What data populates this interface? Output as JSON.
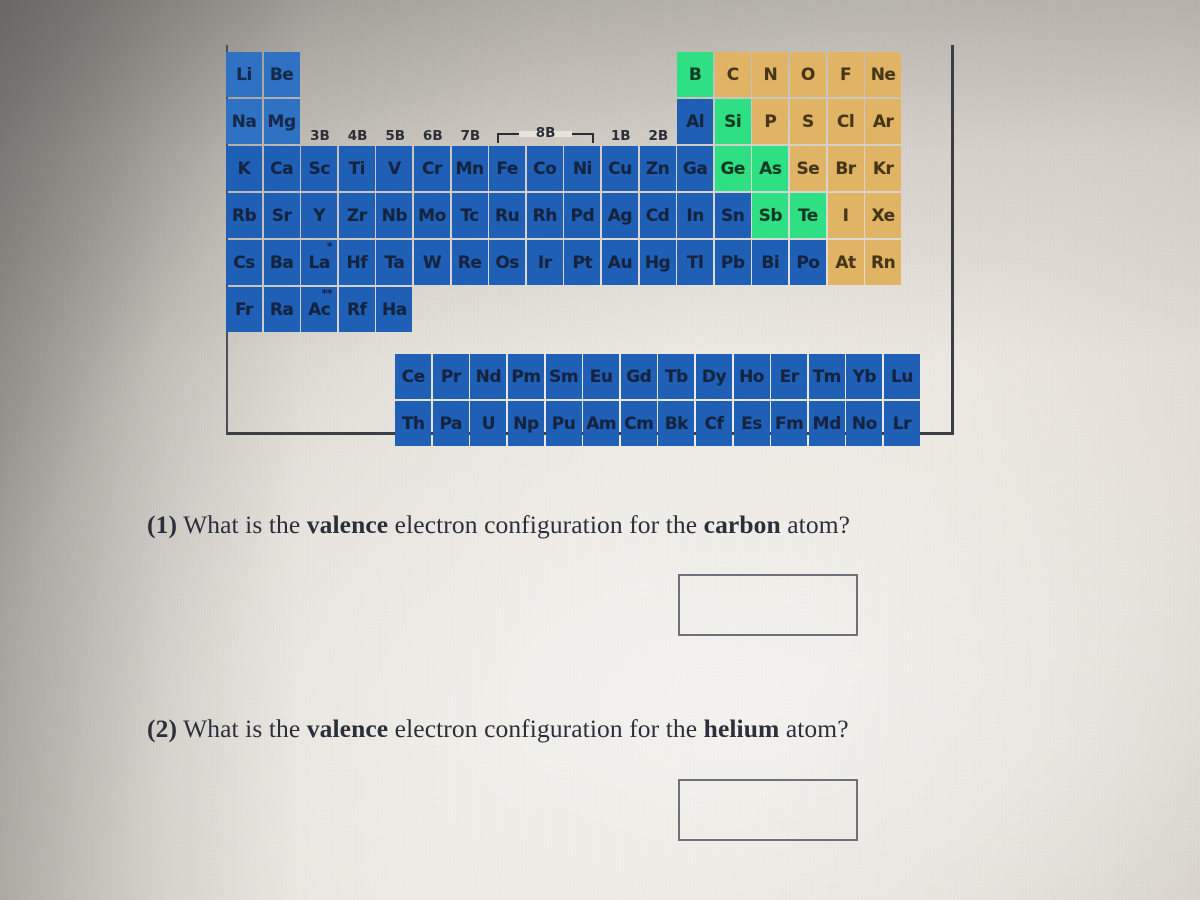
{
  "page": {
    "background_color": "#e7e3db",
    "accent_metal": "#1f60b6",
    "accent_metalloid": "#2fdf83",
    "accent_nonmetal": "#e0b464"
  },
  "periodic_table": {
    "group_labels": [
      "3B",
      "4B",
      "5B",
      "6B",
      "7B",
      "8B",
      "1B",
      "2B"
    ],
    "bracket_label": "8B",
    "rows": [
      {
        "name": "period-2",
        "cells": [
          {
            "symbol": "Li",
            "type": "metal-light"
          },
          {
            "symbol": "Be",
            "type": "metal-light"
          },
          {
            "symbol": "",
            "type": "blank"
          },
          {
            "symbol": "",
            "type": "blank"
          },
          {
            "symbol": "",
            "type": "blank"
          },
          {
            "symbol": "",
            "type": "blank"
          },
          {
            "symbol": "",
            "type": "blank"
          },
          {
            "symbol": "",
            "type": "blank"
          },
          {
            "symbol": "",
            "type": "blank"
          },
          {
            "symbol": "",
            "type": "blank"
          },
          {
            "symbol": "",
            "type": "blank"
          },
          {
            "symbol": "",
            "type": "blank"
          },
          {
            "symbol": "B",
            "type": "metalloid"
          },
          {
            "symbol": "C",
            "type": "nonmetal"
          },
          {
            "symbol": "N",
            "type": "nonmetal"
          },
          {
            "symbol": "O",
            "type": "nonmetal"
          },
          {
            "symbol": "F",
            "type": "nonmetal"
          },
          {
            "symbol": "Ne",
            "type": "nonmetal"
          }
        ]
      },
      {
        "name": "period-3",
        "cells": [
          {
            "symbol": "Na",
            "type": "metal-light"
          },
          {
            "symbol": "Mg",
            "type": "metal-light"
          },
          {
            "symbol": "",
            "type": "blank"
          },
          {
            "symbol": "",
            "type": "blank"
          },
          {
            "symbol": "",
            "type": "blank"
          },
          {
            "symbol": "",
            "type": "blank"
          },
          {
            "symbol": "",
            "type": "blank"
          },
          {
            "symbol": "",
            "type": "blank"
          },
          {
            "symbol": "",
            "type": "blank"
          },
          {
            "symbol": "",
            "type": "blank"
          },
          {
            "symbol": "",
            "type": "blank"
          },
          {
            "symbol": "",
            "type": "blank"
          },
          {
            "symbol": "Al",
            "type": "metal"
          },
          {
            "symbol": "Si",
            "type": "metalloid"
          },
          {
            "symbol": "P",
            "type": "nonmetal"
          },
          {
            "symbol": "S",
            "type": "nonmetal"
          },
          {
            "symbol": "Cl",
            "type": "nonmetal"
          },
          {
            "symbol": "Ar",
            "type": "nonmetal"
          }
        ]
      },
      {
        "name": "period-4",
        "cells": [
          {
            "symbol": "K",
            "type": "metal"
          },
          {
            "symbol": "Ca",
            "type": "metal"
          },
          {
            "symbol": "Sc",
            "type": "metal"
          },
          {
            "symbol": "Ti",
            "type": "metal"
          },
          {
            "symbol": "V",
            "type": "metal"
          },
          {
            "symbol": "Cr",
            "type": "metal"
          },
          {
            "symbol": "Mn",
            "type": "metal"
          },
          {
            "symbol": "Fe",
            "type": "metal"
          },
          {
            "symbol": "Co",
            "type": "metal"
          },
          {
            "symbol": "Ni",
            "type": "metal"
          },
          {
            "symbol": "Cu",
            "type": "metal"
          },
          {
            "symbol": "Zn",
            "type": "metal"
          },
          {
            "symbol": "Ga",
            "type": "metal"
          },
          {
            "symbol": "Ge",
            "type": "metalloid"
          },
          {
            "symbol": "As",
            "type": "metalloid"
          },
          {
            "symbol": "Se",
            "type": "nonmetal"
          },
          {
            "symbol": "Br",
            "type": "nonmetal"
          },
          {
            "symbol": "Kr",
            "type": "nonmetal"
          }
        ]
      },
      {
        "name": "period-5",
        "cells": [
          {
            "symbol": "Rb",
            "type": "metal"
          },
          {
            "symbol": "Sr",
            "type": "metal"
          },
          {
            "symbol": "Y",
            "type": "metal"
          },
          {
            "symbol": "Zr",
            "type": "metal"
          },
          {
            "symbol": "Nb",
            "type": "metal"
          },
          {
            "symbol": "Mo",
            "type": "metal"
          },
          {
            "symbol": "Tc",
            "type": "metal"
          },
          {
            "symbol": "Ru",
            "type": "metal"
          },
          {
            "symbol": "Rh",
            "type": "metal"
          },
          {
            "symbol": "Pd",
            "type": "metal"
          },
          {
            "symbol": "Ag",
            "type": "metal"
          },
          {
            "symbol": "Cd",
            "type": "metal"
          },
          {
            "symbol": "In",
            "type": "metal"
          },
          {
            "symbol": "Sn",
            "type": "metal"
          },
          {
            "symbol": "Sb",
            "type": "metalloid"
          },
          {
            "symbol": "Te",
            "type": "metalloid"
          },
          {
            "symbol": "I",
            "type": "nonmetal"
          },
          {
            "symbol": "Xe",
            "type": "nonmetal"
          }
        ]
      },
      {
        "name": "period-6",
        "cells": [
          {
            "symbol": "Cs",
            "type": "metal"
          },
          {
            "symbol": "Ba",
            "type": "metal"
          },
          {
            "symbol": "La",
            "type": "metal",
            "marker": "*"
          },
          {
            "symbol": "Hf",
            "type": "metal"
          },
          {
            "symbol": "Ta",
            "type": "metal"
          },
          {
            "symbol": "W",
            "type": "metal"
          },
          {
            "symbol": "Re",
            "type": "metal"
          },
          {
            "symbol": "Os",
            "type": "metal"
          },
          {
            "symbol": "Ir",
            "type": "metal"
          },
          {
            "symbol": "Pt",
            "type": "metal"
          },
          {
            "symbol": "Au",
            "type": "metal"
          },
          {
            "symbol": "Hg",
            "type": "metal"
          },
          {
            "symbol": "Tl",
            "type": "metal"
          },
          {
            "symbol": "Pb",
            "type": "metal"
          },
          {
            "symbol": "Bi",
            "type": "metal"
          },
          {
            "symbol": "Po",
            "type": "metal"
          },
          {
            "symbol": "At",
            "type": "nonmetal"
          },
          {
            "symbol": "Rn",
            "type": "nonmetal"
          }
        ]
      },
      {
        "name": "period-7",
        "cells": [
          {
            "symbol": "Fr",
            "type": "metal"
          },
          {
            "symbol": "Ra",
            "type": "metal"
          },
          {
            "symbol": "Ac",
            "type": "metal",
            "marker": "**"
          },
          {
            "symbol": "Rf",
            "type": "metal"
          },
          {
            "symbol": "Ha",
            "type": "metal"
          }
        ]
      }
    ],
    "lanthanides": {
      "name": "lanthanide-series",
      "cells": [
        {
          "symbol": "Ce",
          "type": "metal"
        },
        {
          "symbol": "Pr",
          "type": "metal"
        },
        {
          "symbol": "Nd",
          "type": "metal"
        },
        {
          "symbol": "Pm",
          "type": "metal"
        },
        {
          "symbol": "Sm",
          "type": "metal"
        },
        {
          "symbol": "Eu",
          "type": "metal"
        },
        {
          "symbol": "Gd",
          "type": "metal"
        },
        {
          "symbol": "Tb",
          "type": "metal"
        },
        {
          "symbol": "Dy",
          "type": "metal"
        },
        {
          "symbol": "Ho",
          "type": "metal"
        },
        {
          "symbol": "Er",
          "type": "metal"
        },
        {
          "symbol": "Tm",
          "type": "metal"
        },
        {
          "symbol": "Yb",
          "type": "metal"
        },
        {
          "symbol": "Lu",
          "type": "metal"
        }
      ]
    },
    "actinides": {
      "name": "actinide-series",
      "cells": [
        {
          "symbol": "Th",
          "type": "metal"
        },
        {
          "symbol": "Pa",
          "type": "metal"
        },
        {
          "symbol": "U",
          "type": "metal"
        },
        {
          "symbol": "Np",
          "type": "metal"
        },
        {
          "symbol": "Pu",
          "type": "metal"
        },
        {
          "symbol": "Am",
          "type": "metal"
        },
        {
          "symbol": "Cm",
          "type": "metal"
        },
        {
          "symbol": "Bk",
          "type": "metal"
        },
        {
          "symbol": "Cf",
          "type": "metal"
        },
        {
          "symbol": "Es",
          "type": "metal"
        },
        {
          "symbol": "Fm",
          "type": "metal"
        },
        {
          "symbol": "Md",
          "type": "metal"
        },
        {
          "symbol": "No",
          "type": "metal"
        },
        {
          "symbol": "Lr",
          "type": "metal"
        }
      ]
    }
  },
  "questions": [
    {
      "number": "(1)",
      "text_parts": [
        {
          "text": "What is the ",
          "bold": false
        },
        {
          "text": "valence",
          "bold": true
        },
        {
          "text": " electron configuration for the ",
          "bold": false
        },
        {
          "text": "carbon",
          "bold": true
        },
        {
          "text": " atom?",
          "bold": false
        }
      ],
      "answer_value": "",
      "answer_placeholder": ""
    },
    {
      "number": "(2)",
      "text_parts": [
        {
          "text": "What is the ",
          "bold": false
        },
        {
          "text": "valence",
          "bold": true
        },
        {
          "text": " electron configuration for the ",
          "bold": false
        },
        {
          "text": "helium",
          "bold": true
        },
        {
          "text": " atom?",
          "bold": false
        }
      ],
      "answer_value": "",
      "answer_placeholder": ""
    }
  ]
}
